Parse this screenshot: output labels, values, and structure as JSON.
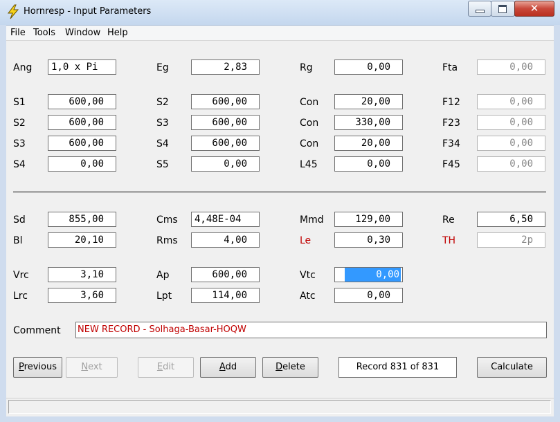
{
  "window": {
    "title": "Hornresp - Input Parameters",
    "close_glyph": "✕"
  },
  "menu": [
    "File",
    "Tools",
    "Window",
    "Help"
  ],
  "fields": {
    "ang": {
      "label": "Ang",
      "value": "1,0 x Pi"
    },
    "eg": {
      "label": "Eg",
      "value": "2,83"
    },
    "rg": {
      "label": "Rg",
      "value": "0,00"
    },
    "fta": {
      "label": "Fta",
      "value": "0,00"
    },
    "s1": {
      "label": "S1",
      "value": "600,00"
    },
    "s2a": {
      "label": "S2",
      "value": "600,00"
    },
    "con1": {
      "label": "Con",
      "value": "20,00"
    },
    "f12": {
      "label": "F12",
      "value": "0,00"
    },
    "s2b": {
      "label": "S2",
      "value": "600,00"
    },
    "s3a": {
      "label": "S3",
      "value": "600,00"
    },
    "con2": {
      "label": "Con",
      "value": "330,00"
    },
    "f23": {
      "label": "F23",
      "value": "0,00"
    },
    "s3b": {
      "label": "S3",
      "value": "600,00"
    },
    "s4a": {
      "label": "S4",
      "value": "600,00"
    },
    "con3": {
      "label": "Con",
      "value": "20,00"
    },
    "f34": {
      "label": "F34",
      "value": "0,00"
    },
    "s4b": {
      "label": "S4",
      "value": "0,00"
    },
    "s5": {
      "label": "S5",
      "value": "0,00"
    },
    "l45": {
      "label": "L45",
      "value": "0,00"
    },
    "f45": {
      "label": "F45",
      "value": "0,00"
    },
    "sd": {
      "label": "Sd",
      "value": "855,00"
    },
    "cms": {
      "label": "Cms",
      "value": "4,48E-04"
    },
    "mmd": {
      "label": "Mmd",
      "value": "129,00"
    },
    "re": {
      "label": "Re",
      "value": "6,50"
    },
    "bl": {
      "label": "Bl",
      "value": "20,10"
    },
    "rms": {
      "label": "Rms",
      "value": "4,00"
    },
    "le": {
      "label": "Le",
      "value": "0,30"
    },
    "th": {
      "label": "TH",
      "value": "2p"
    },
    "vrc": {
      "label": "Vrc",
      "value": "3,10"
    },
    "ap": {
      "label": "Ap",
      "value": "600,00"
    },
    "vtc": {
      "label": "Vtc",
      "value": "0,00"
    },
    "lrc": {
      "label": "Lrc",
      "value": "3,60"
    },
    "lpt": {
      "label": "Lpt",
      "value": "114,00"
    },
    "atc": {
      "label": "Atc",
      "value": "0,00"
    }
  },
  "comment": {
    "label": "Comment",
    "value": "NEW RECORD - Solhaga-Basar-HOQW"
  },
  "buttons": {
    "previous": {
      "mnemonic": "P",
      "rest": "revious"
    },
    "next": {
      "mnemonic": "N",
      "rest": "ext"
    },
    "edit": {
      "mnemonic": "E",
      "rest": "dit"
    },
    "add": {
      "mnemonic": "A",
      "rest": "dd"
    },
    "delete": {
      "mnemonic": "D",
      "rest": "elete"
    },
    "calculate": {
      "label": "Calculate"
    }
  },
  "record": {
    "label": "Record 831 of 831"
  },
  "colors": {
    "accent_red": "#c00000",
    "selection": "#3399ff"
  }
}
